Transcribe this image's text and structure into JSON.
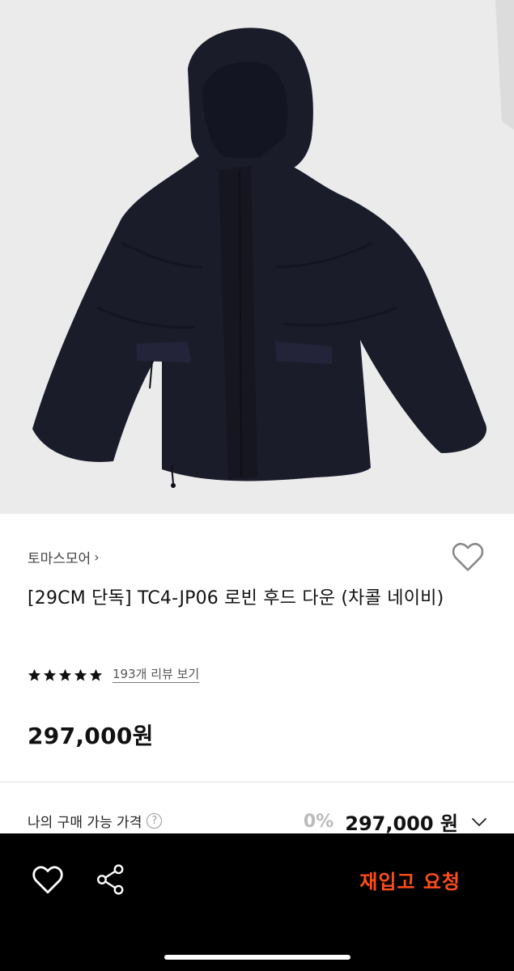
{
  "product": {
    "image_icon": "down-jacket-photo",
    "brand": "토마스모어",
    "title": "[29CM 단독] TC4-JP06 로빈 후드 다운 (차콜 네이비)",
    "rating": 5,
    "review_link": "193개 리뷰 보기",
    "price": "297,000원"
  },
  "my_price": {
    "label": "나의 구매 가능 가격",
    "help_icon": "?",
    "discount": "0%",
    "price": "297,000 원"
  },
  "bottom_bar": {
    "like_icon": "heart-icon",
    "share_icon": "share-icon",
    "restock_label": "재입고 요청"
  },
  "colors": {
    "accent": "#ff4d1a",
    "bar_bg": "#000000",
    "jacket": "#1b1c2a"
  }
}
